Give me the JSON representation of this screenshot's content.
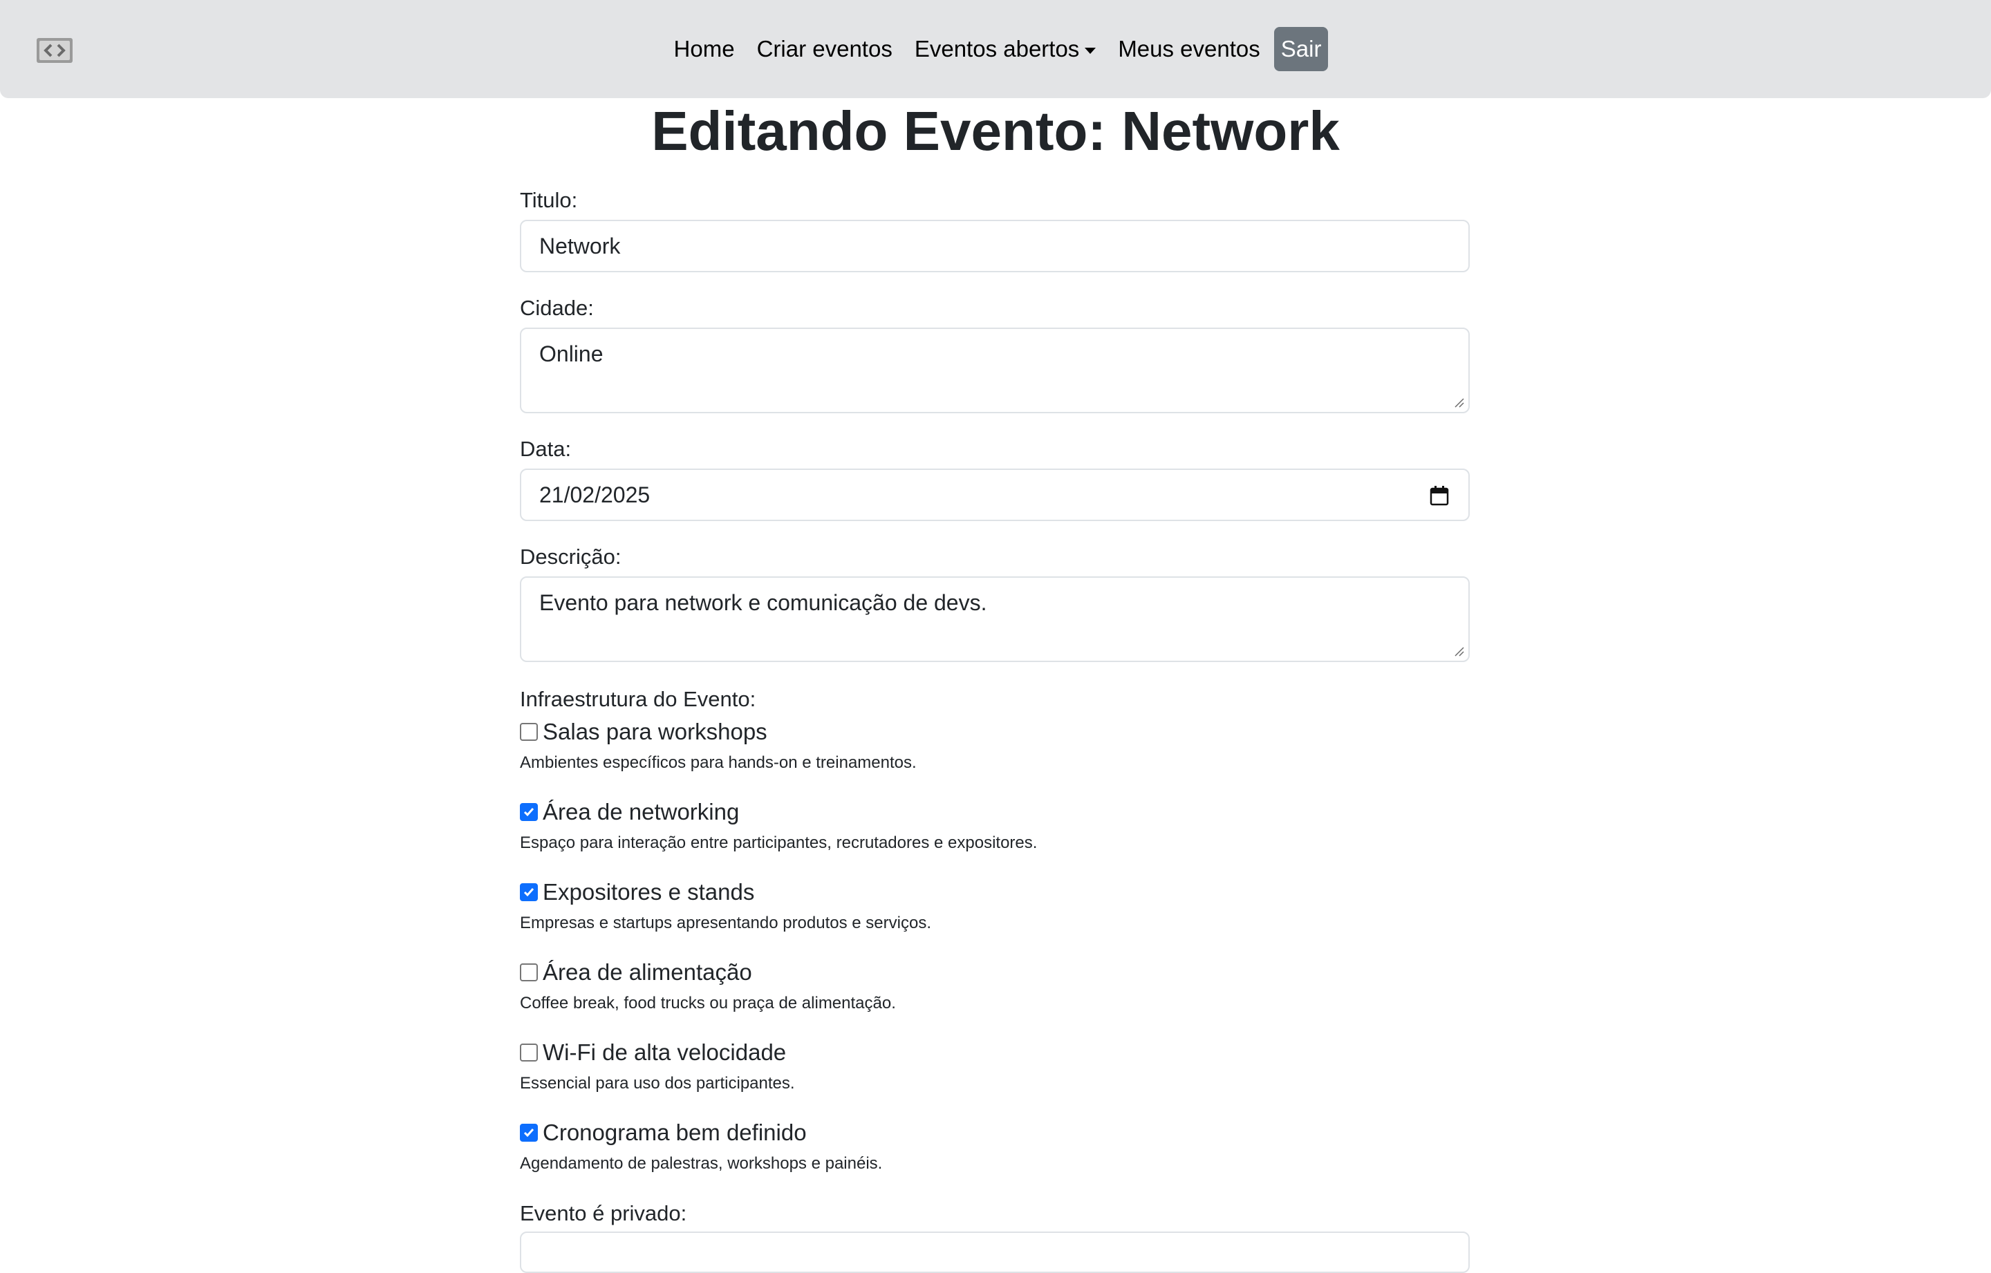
{
  "nav": {
    "logo_icon": "code-brackets-icon",
    "links": [
      "Home",
      "Criar eventos",
      "Eventos abertos",
      "Meus eventos"
    ],
    "logout": "Sair"
  },
  "page": {
    "title": "Editando Evento: Network"
  },
  "form": {
    "titulo": {
      "label": "Titulo:",
      "value": "Network"
    },
    "cidade": {
      "label": "Cidade:",
      "value": "Online"
    },
    "data": {
      "label": "Data:",
      "value": "21/02/2025"
    },
    "descricao": {
      "label": "Descrição:",
      "value": "Evento para network e comunicação de devs."
    },
    "infra_label": "Infraestrutura do Evento:",
    "items": [
      {
        "label": "Salas para workshops",
        "desc": "Ambientes específicos para hands-on e treinamentos.",
        "checked": false
      },
      {
        "label": "Área de networking",
        "desc": "Espaço para interação entre participantes, recrutadores e expositores.",
        "checked": true
      },
      {
        "label": "Expositores e stands",
        "desc": "Empresas e startups apresentando produtos e serviços.",
        "checked": true
      },
      {
        "label": "Área de alimentação",
        "desc": "Coffee break, food trucks ou praça de alimentação.",
        "checked": false
      },
      {
        "label": "Wi-Fi de alta velocidade",
        "desc": "Essencial para uso dos participantes.",
        "checked": false
      },
      {
        "label": "Cronograma bem definido",
        "desc": "Agendamento de palestras, workshops e painéis.",
        "checked": true
      }
    ],
    "privado_label": "Evento é privado:"
  },
  "colors": {
    "navbar_bg": "#e3e4e6",
    "button_bg": "#6c757d",
    "checkbox_checked": "#0d6efd"
  }
}
